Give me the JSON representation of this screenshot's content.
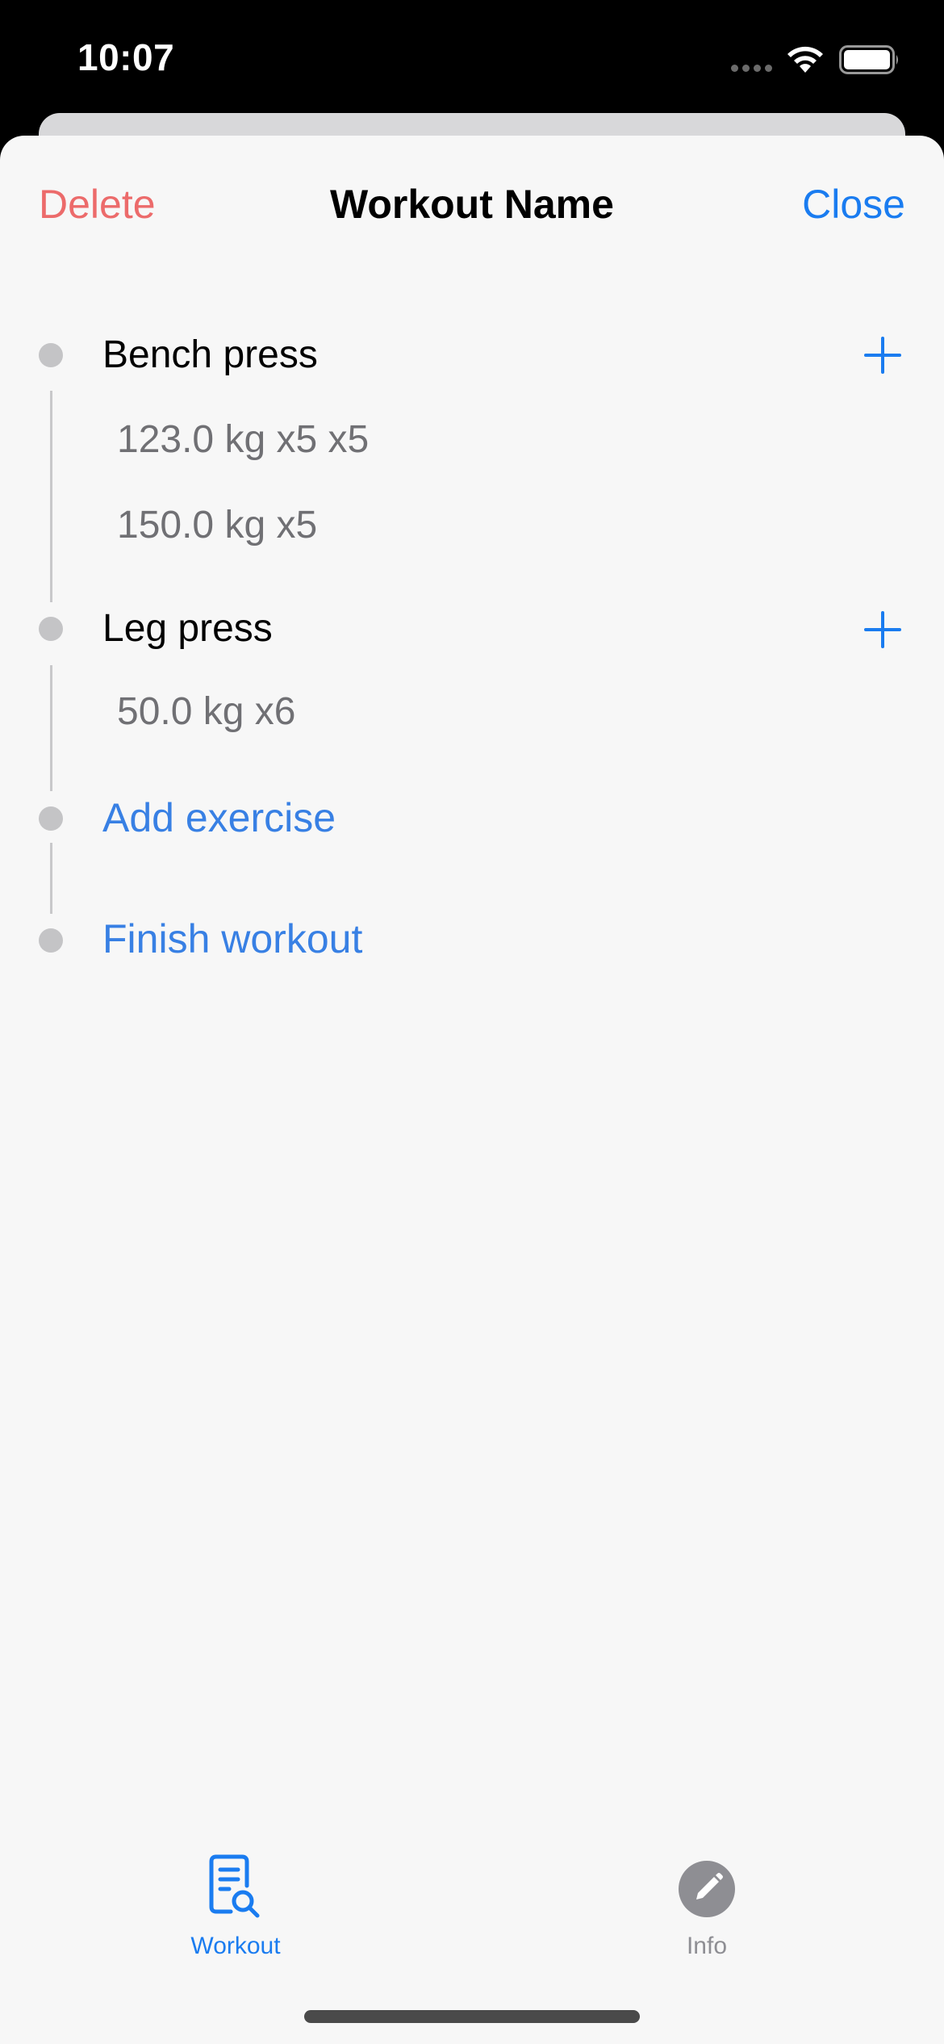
{
  "status_bar": {
    "time": "10:07"
  },
  "nav": {
    "delete_label": "Delete",
    "title": "Workout Name",
    "close_label": "Close"
  },
  "exercises": [
    {
      "name": "Bench press",
      "sets": [
        "123.0 kg x5 x5",
        "150.0 kg x5"
      ]
    },
    {
      "name": "Leg press",
      "sets": [
        "50.0 kg x6"
      ]
    }
  ],
  "actions": {
    "add_exercise": "Add exercise",
    "finish_workout": "Finish workout"
  },
  "tabs": [
    {
      "label": "Workout",
      "icon": "document-search-icon",
      "selected": true
    },
    {
      "label": "Info",
      "icon": "pencil-circle-icon",
      "selected": false
    }
  ],
  "colors": {
    "accent": "#1a7cf0",
    "link": "#3880e4",
    "destructive": "#ec6b6b",
    "secondary_text": "#707074",
    "tab_inactive": "#8e8e93",
    "timeline": "#c4c4c6"
  }
}
